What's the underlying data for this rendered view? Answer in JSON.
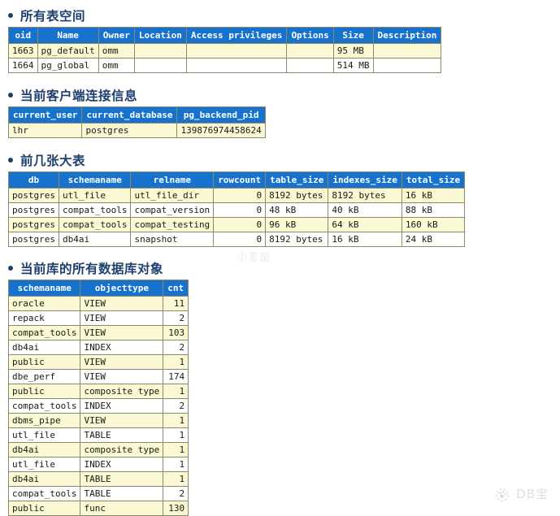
{
  "watermarks": {
    "center_text": "小麦苗",
    "logo_text": "DB宝",
    "logo_icon": "paw-bubble-icon"
  },
  "sections": [
    {
      "id": "tablespaces",
      "heading": "所有表空间",
      "columns": [
        "oid",
        "Name",
        "Owner",
        "Location",
        "Access privileges",
        "Options",
        "Size",
        "Description"
      ],
      "aligns": [
        "num",
        "txt",
        "txt",
        "txt",
        "txt",
        "txt",
        "txt",
        "txt"
      ],
      "rows": [
        [
          "1663",
          "pg_default",
          "omm",
          "",
          "",
          "",
          "95 MB",
          ""
        ],
        [
          "1664",
          "pg_global",
          "omm",
          "",
          "",
          "",
          "514 MB",
          ""
        ]
      ]
    },
    {
      "id": "connection",
      "heading": "当前客户端连接信息",
      "columns": [
        "current_user",
        "current_database",
        "pg_backend_pid"
      ],
      "aligns": [
        "txt",
        "txt",
        "txt"
      ],
      "rows": [
        [
          "lhr",
          "postgres",
          "139876974458624"
        ]
      ]
    },
    {
      "id": "bigtables",
      "heading": "前几张大表",
      "columns": [
        "db",
        "schemaname",
        "relname",
        "rowcount",
        "table_size",
        "indexes_size",
        "total_size"
      ],
      "aligns": [
        "txt",
        "txt",
        "txt",
        "num",
        "txt",
        "txt",
        "txt"
      ],
      "rows": [
        [
          "postgres",
          "utl_file",
          "utl_file_dir",
          "0",
          "8192 bytes",
          "8192 bytes",
          "16 kB"
        ],
        [
          "postgres",
          "compat_tools",
          "compat_version",
          "0",
          "48 kB",
          "40 kB",
          "88 kB"
        ],
        [
          "postgres",
          "compat_tools",
          "compat_testing",
          "0",
          "96 kB",
          "64 kB",
          "160 kB"
        ],
        [
          "postgres",
          "db4ai",
          "snapshot",
          "0",
          "8192 bytes",
          "16 kB",
          "24 kB"
        ]
      ]
    },
    {
      "id": "objects",
      "heading": "当前库的所有数据库对象",
      "columns": [
        "schemaname",
        "objecttype",
        "cnt"
      ],
      "aligns": [
        "txt",
        "txt",
        "num"
      ],
      "rows": [
        [
          "oracle",
          "VIEW",
          "11"
        ],
        [
          "repack",
          "VIEW",
          "2"
        ],
        [
          "compat_tools",
          "VIEW",
          "103"
        ],
        [
          "db4ai",
          "INDEX",
          "2"
        ],
        [
          "public",
          "VIEW",
          "1"
        ],
        [
          "dbe_perf",
          "VIEW",
          "174"
        ],
        [
          "public",
          "composite type",
          "1"
        ],
        [
          "compat_tools",
          "INDEX",
          "2"
        ],
        [
          "dbms_pipe",
          "VIEW",
          "1"
        ],
        [
          "utl_file",
          "TABLE",
          "1"
        ],
        [
          "db4ai",
          "composite type",
          "1"
        ],
        [
          "utl_file",
          "INDEX",
          "1"
        ],
        [
          "db4ai",
          "TABLE",
          "1"
        ],
        [
          "compat_tools",
          "TABLE",
          "2"
        ],
        [
          "public",
          "func",
          "130"
        ]
      ]
    }
  ],
  "colors": {
    "header_bg": "#1772cd",
    "header_fg": "#ffffff",
    "row_odd_bg": "#fbf8d4",
    "row_even_bg": "#ffffff",
    "border": "#8a8a6a",
    "heading_fg": "#1f3f6e"
  }
}
